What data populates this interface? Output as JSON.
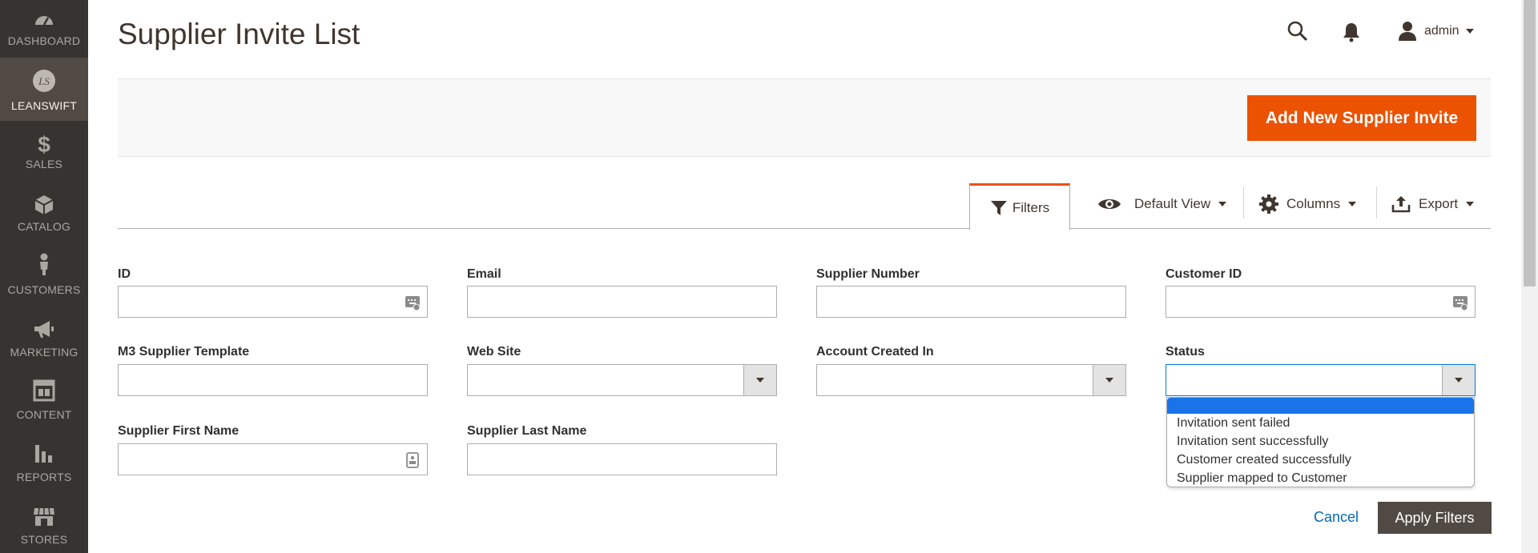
{
  "sidebar": {
    "items": [
      {
        "label": "DASHBOARD",
        "icon": "dashboard-icon"
      },
      {
        "label": "LEANSWIFT",
        "icon": "leanswift-logo-icon",
        "logo_text": "LS"
      },
      {
        "label": "SALES",
        "icon": "dollar-icon"
      },
      {
        "label": "CATALOG",
        "icon": "cube-icon"
      },
      {
        "label": "CUSTOMERS",
        "icon": "person-icon"
      },
      {
        "label": "MARKETING",
        "icon": "megaphone-icon"
      },
      {
        "label": "CONTENT",
        "icon": "layout-icon"
      },
      {
        "label": "REPORTS",
        "icon": "bar-chart-icon"
      },
      {
        "label": "STORES",
        "icon": "storefront-icon"
      }
    ],
    "active_index": 1
  },
  "header": {
    "title": "Supplier Invite List",
    "user": "admin"
  },
  "actions": {
    "add_button": "Add New Supplier Invite"
  },
  "toolbar": {
    "filters": "Filters",
    "view": "Default View",
    "columns": "Columns",
    "export": "Export"
  },
  "filters": {
    "id": {
      "label": "ID",
      "value": ""
    },
    "email": {
      "label": "Email",
      "value": ""
    },
    "supplier_number": {
      "label": "Supplier Number",
      "value": ""
    },
    "customer_id": {
      "label": "Customer ID",
      "value": ""
    },
    "m3_template": {
      "label": "M3 Supplier Template",
      "value": ""
    },
    "website": {
      "label": "Web Site",
      "value": ""
    },
    "account_created_in": {
      "label": "Account Created In",
      "value": ""
    },
    "status": {
      "label": "Status",
      "value": ""
    },
    "first_name": {
      "label": "Supplier First Name",
      "value": ""
    },
    "last_name": {
      "label": "Supplier Last Name",
      "value": ""
    }
  },
  "status_options": [
    "",
    "Invitation sent failed",
    "Invitation sent successfully",
    "Customer created successfully",
    "Supplier mapped to Customer"
  ],
  "buttons": {
    "cancel": "Cancel",
    "apply": "Apply Filters"
  },
  "colors": {
    "sidebar_bg": "#373330",
    "accent": "#eb5202",
    "highlight": "#1a73e8",
    "link": "#006bb4"
  }
}
